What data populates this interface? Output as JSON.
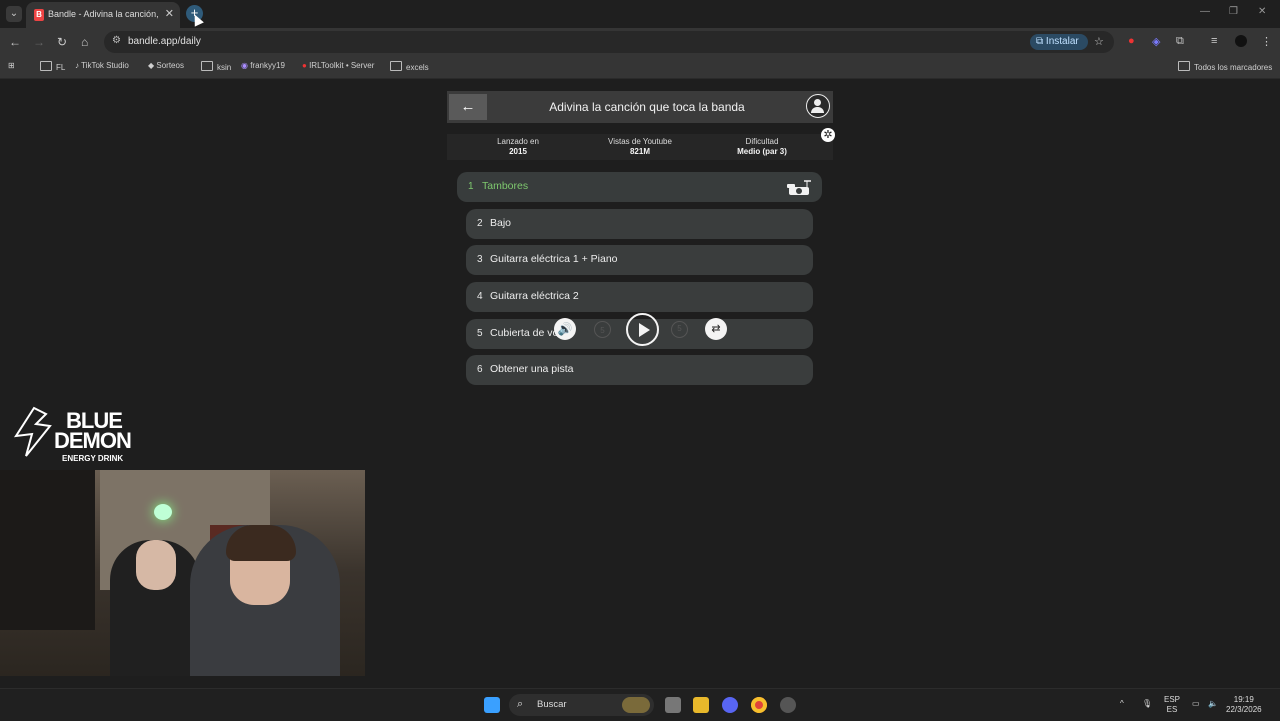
{
  "browser": {
    "tab_title": "Bandle - Adivina la canción, un",
    "url": "bandle.app/daily",
    "install_label": "Instalar",
    "bookmarks": [
      "FL",
      "TikTok Studio",
      "Sorteos",
      "ksin",
      "frankyy19",
      "IRLToolkit • Server",
      "excels"
    ],
    "all_bookmarks_label": "Todos los marcadores"
  },
  "app": {
    "header_title": "Adivina la canción que toca la banda",
    "info": [
      {
        "label": "Lanzado en",
        "value": "2015"
      },
      {
        "label": "Vistas de Youtube",
        "value": "821M"
      },
      {
        "label": "Dificultad",
        "value": "Medio (par 3)"
      }
    ],
    "tracks": [
      {
        "num": "1",
        "label": "Tambores",
        "active": true
      },
      {
        "num": "2",
        "label": "Bajo"
      },
      {
        "num": "3",
        "label": "Guitarra eléctrica 1 + Piano"
      },
      {
        "num": "4",
        "label": "Guitarra eléctrica 2"
      },
      {
        "num": "5",
        "label": "Cubierta de voz"
      },
      {
        "num": "6",
        "label": "Obtener una pista"
      }
    ],
    "skip_back_label": "5",
    "skip_fwd_label": "5",
    "accent_color": "#7ec86e"
  },
  "overlay": {
    "logo_line1": "BLUE",
    "logo_line2": "DEMON",
    "logo_line3": "ENERGY DRINK"
  },
  "taskbar": {
    "search_placeholder": "Buscar",
    "lang_top": "ESP",
    "lang_bottom": "ES",
    "time": "19:19",
    "date": "22/3/2026"
  }
}
